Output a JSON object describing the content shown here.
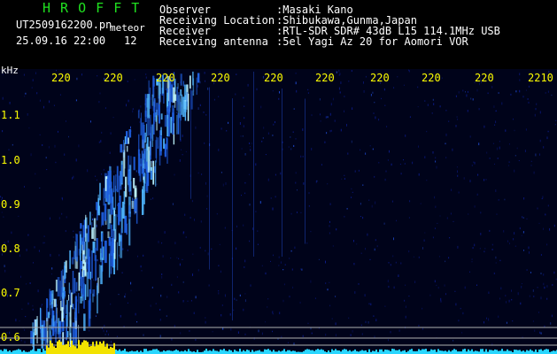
{
  "brand": {
    "name": "H R O F F T",
    "color": "#20e020"
  },
  "capture": {
    "file_name": "UT2509162200.pn",
    "tag": "meteor",
    "datetime": "25.09.16 22:00",
    "count": "12"
  },
  "info": {
    "observer_label": "Observer",
    "observer_value": ":Masaki Kano",
    "location_label": "Receiving Location",
    "location_value": ":Shibukawa,Gunma,Japan",
    "receiver_label": "Receiver",
    "receiver_value": ":RTL-SDR SDR# 43dB L15 114.1MHz USB",
    "antenna_label": "Receiving antenna",
    "antenna_value": ":5el Yagi Az 20 for Aomori VOR"
  },
  "axis": {
    "unit": "kHz",
    "x_ticks": [
      "220",
      "220",
      "220",
      "220",
      "220",
      "220",
      "220",
      "220",
      "220",
      "2210"
    ],
    "y_ticks": [
      "1.1",
      "1.0",
      "0.9",
      "0.8",
      "0.7",
      "0.6"
    ]
  },
  "colors": {
    "tick_color": "#ffff00",
    "grid_line": "#b0b0b0",
    "signal_low": "#0b1a8a",
    "signal_high": "#e8ffff"
  }
}
